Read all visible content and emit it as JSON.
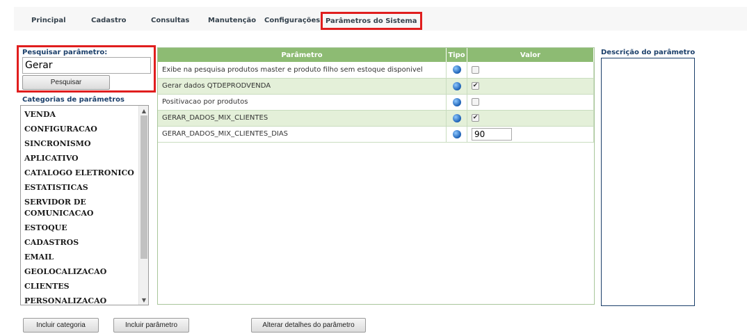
{
  "nav": {
    "tabs": [
      {
        "label": "Principal"
      },
      {
        "label": "Cadastro"
      },
      {
        "label": "Consultas"
      },
      {
        "label": "Manutenção"
      },
      {
        "label": "Configurações"
      },
      {
        "label": "Parâmetros do Sistema",
        "active": true
      }
    ]
  },
  "search": {
    "label": "Pesquisar parâmetro:",
    "value": "Gerar",
    "button_label": "Pesquisar"
  },
  "categories": {
    "label": "Categorias de parâmetros",
    "items": [
      "VENDA",
      "CONFIGURACAO",
      "SINCRONISMO",
      "APLICATIVO",
      "CATALOGO ELETRONICO",
      "ESTATISTICAS",
      "SERVIDOR DE COMUNICACAO",
      "ESTOQUE",
      "CADASTROS",
      "EMAIL",
      "GEOLOCALIZACAO",
      "CLIENTES",
      "PERSONALIZACAO"
    ]
  },
  "table": {
    "headers": {
      "parametro": "Parâmetro",
      "tipo": "Tipo",
      "valor": "Valor"
    },
    "rows": [
      {
        "parametro": "Exibe na pesquisa produtos master e produto filho sem estoque disponivel",
        "tipo_icon": "globe-icon",
        "valor_type": "checkbox",
        "checked": false
      },
      {
        "parametro": "Gerar dados QTDEPRODVENDA",
        "tipo_icon": "globe-icon",
        "valor_type": "checkbox",
        "checked": true
      },
      {
        "parametro": "Positivacao por produtos",
        "tipo_icon": "globe-icon",
        "valor_type": "checkbox",
        "checked": false
      },
      {
        "parametro": "GERAR_DADOS_MIX_CLIENTES",
        "tipo_icon": "globe-icon",
        "valor_type": "checkbox",
        "checked": true
      },
      {
        "parametro": "GERAR_DADOS_MIX_CLIENTES_DIAS",
        "tipo_icon": "globe-icon",
        "valor_type": "text",
        "value": "90"
      }
    ]
  },
  "description": {
    "label": "Descrição do parâmetro",
    "text": ""
  },
  "buttons": {
    "incluir_categoria": "Incluir categoria",
    "incluir_parametro": "Incluir parâmetro",
    "alterar_detalhes": "Alterar detalhes do parâmetro"
  },
  "colors": {
    "header_green": "#8dbb73",
    "row_alt_green": "#e4f0d9",
    "highlight_red": "#e01e1e",
    "label_blue": "#1b3f6a"
  }
}
